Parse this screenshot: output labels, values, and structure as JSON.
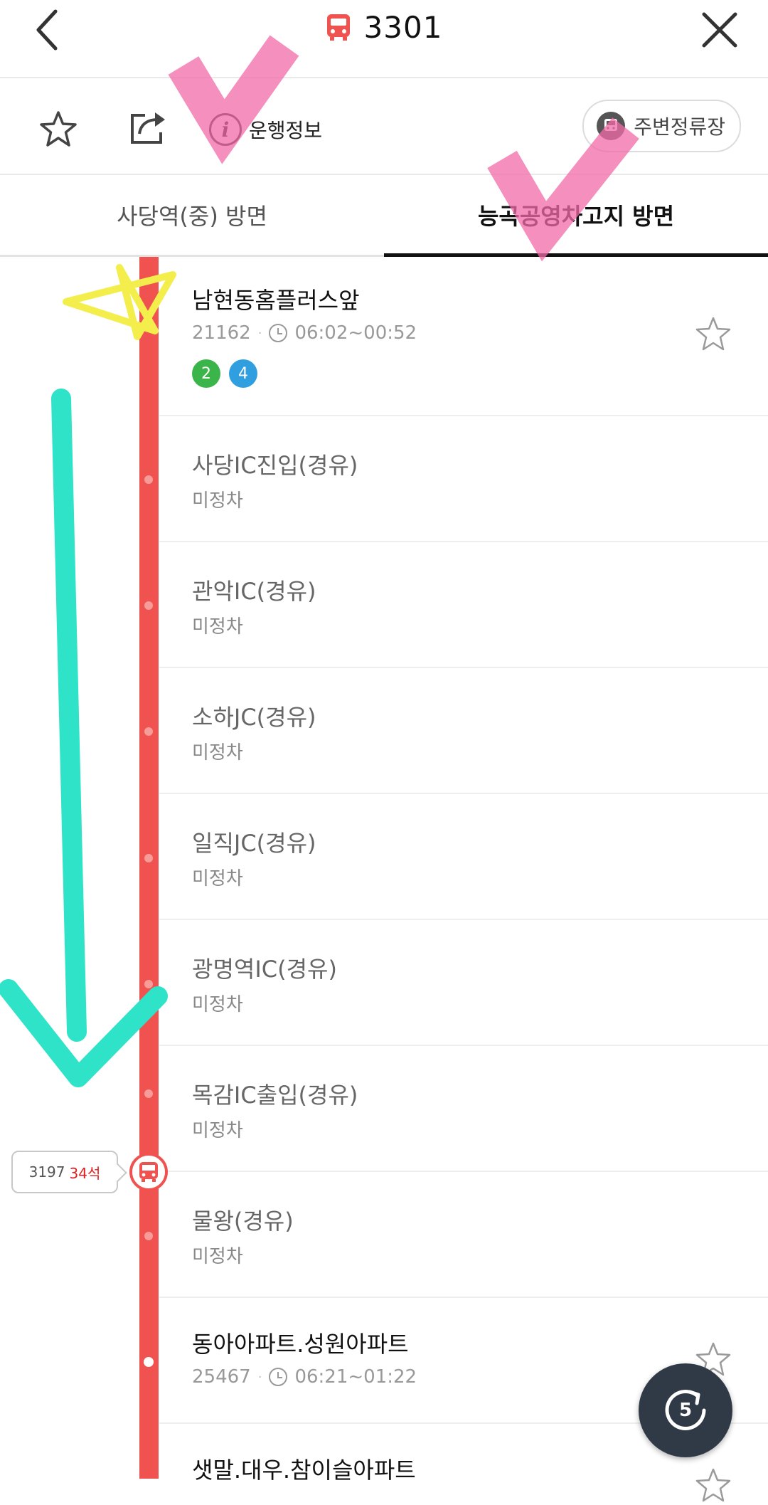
{
  "header": {
    "route_number": "3301",
    "bus_icon_color": "#f0534f"
  },
  "actions": {
    "info_label": "운행정보",
    "nearby_label": "주변정류장"
  },
  "tabs": [
    {
      "label": "사당역(중) 방면",
      "active": false
    },
    {
      "label": "능곡공영차고지 방면",
      "active": true
    }
  ],
  "stops": [
    {
      "name": "남현동홈플러스앞",
      "id": "21162",
      "sep": "·",
      "time": "06:02~00:52",
      "lines": [
        "2",
        "4"
      ],
      "line_colors": [
        "#3bb44a",
        "#2f9fe0"
      ]
    },
    {
      "name": "사당IC진입(경유)",
      "sub": "미정차"
    },
    {
      "name": "관악IC(경유)",
      "sub": "미정차"
    },
    {
      "name": "소하JC(경유)",
      "sub": "미정차"
    },
    {
      "name": "일직JC(경유)",
      "sub": "미정차"
    },
    {
      "name": "광명역IC(경유)",
      "sub": "미정차"
    },
    {
      "name": "목감IC출입(경유)",
      "sub": "미정차"
    },
    {
      "name": "물왕(경유)",
      "sub": "미정차"
    },
    {
      "name": "동아아파트.성원아파트",
      "id": "25467",
      "sep": "·",
      "time": "06:21~01:22"
    },
    {
      "name": "샛말.대우.참이슬아파트"
    }
  ],
  "bus": {
    "plate": "3197",
    "seats": "34석"
  },
  "refresh": {
    "count": "5"
  },
  "colors": {
    "route_line": "#f0534f",
    "doodle_pink": "#f06aa8",
    "doodle_teal": "#2ee3c8",
    "doodle_yellow": "#f4ee4d"
  }
}
